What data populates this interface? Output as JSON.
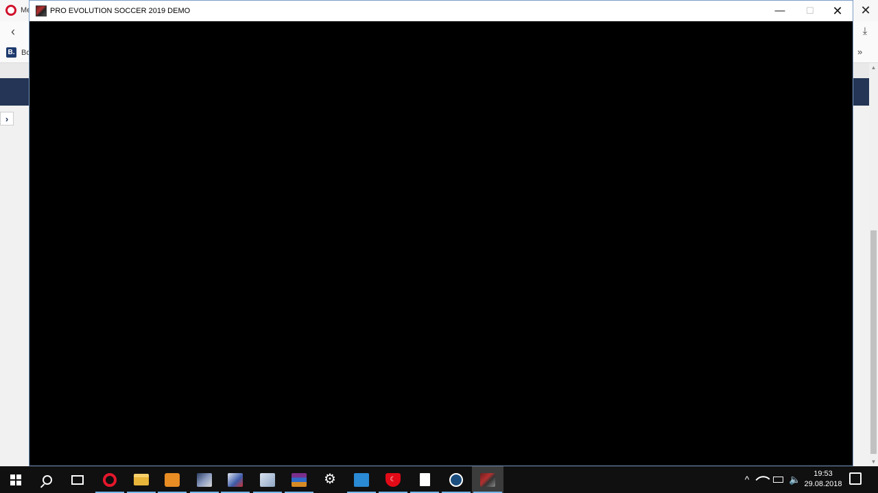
{
  "browser": {
    "tab_label": "Me",
    "back_icon": "back-arrow-icon",
    "download_icon": "download-icon",
    "bookmark_icon_text": "B.",
    "bookmark_label": "Bo",
    "bookmarks_more": "»",
    "close_glyph": "✕",
    "side_arrow": "›"
  },
  "game_window": {
    "title": "PRO EVOLUTION SOCCER 2019 DEMO",
    "minimize": "—",
    "maximize": "☐",
    "close": "✕"
  },
  "taskbar": {
    "items": [
      {
        "name": "start",
        "icon": "windows-icon",
        "open": false
      },
      {
        "name": "search",
        "icon": "search-icon",
        "open": false
      },
      {
        "name": "task-view",
        "icon": "task-view-icon",
        "open": false
      },
      {
        "name": "opera",
        "icon": "opera-icon",
        "open": true
      },
      {
        "name": "file-explorer",
        "icon": "folder-icon",
        "open": true
      },
      {
        "name": "media-player",
        "icon": "media-player-icon",
        "open": true
      },
      {
        "name": "pes-launcher",
        "icon": "pes-icon",
        "open": true
      },
      {
        "name": "tool-app",
        "icon": "tool-icon",
        "open": true
      },
      {
        "name": "documents-app",
        "icon": "documents-icon",
        "open": true
      },
      {
        "name": "winrar",
        "icon": "winrar-icon",
        "open": true
      },
      {
        "name": "settings",
        "icon": "gear-icon",
        "open": false
      },
      {
        "name": "telemetry-app",
        "icon": "monitor-icon",
        "open": true
      },
      {
        "name": "shield-app",
        "icon": "shield-icon",
        "open": true
      },
      {
        "name": "blank-file",
        "icon": "file-icon",
        "open": true
      },
      {
        "name": "steam",
        "icon": "steam-icon",
        "open": true
      },
      {
        "name": "pes-2019-demo",
        "icon": "pes-game-icon",
        "open": true,
        "active": true
      }
    ],
    "tray": {
      "chevron": "^",
      "volume_glyph": "🔈",
      "time": "19:53",
      "date": "29.08.2018"
    }
  }
}
